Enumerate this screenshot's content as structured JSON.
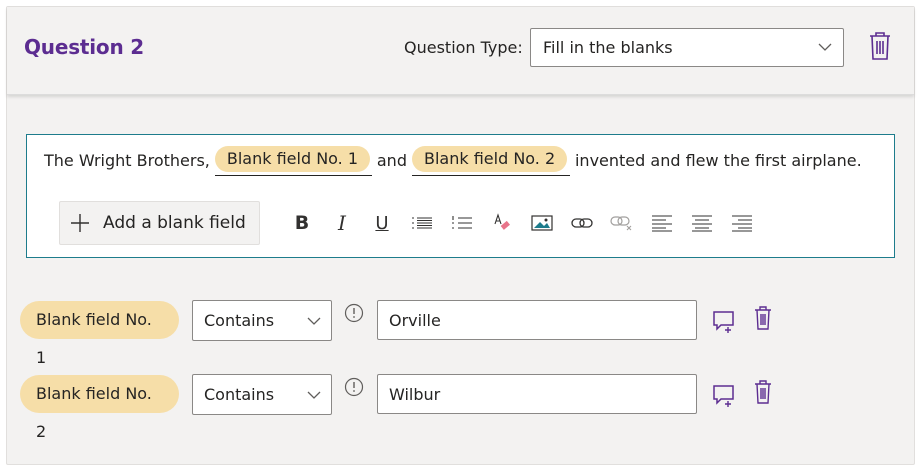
{
  "question": {
    "title": "Question 2",
    "type_label": "Question Type:",
    "type_value": "Fill in the blanks"
  },
  "editor": {
    "text_before": "The Wright Brothers,",
    "blank1": "Blank field No. 1",
    "text_middle": "and",
    "blank2": "Blank field No. 2",
    "text_after": "invented and flew the first airplane.",
    "add_blank_label": "Add a blank field",
    "toolbar": {
      "bold": "B",
      "italic": "I",
      "underline": "U",
      "icons": [
        "bold-icon",
        "italic-icon",
        "underline-icon",
        "bulleted-list-icon",
        "numbered-list-icon",
        "clear-format-icon",
        "image-icon",
        "link-icon",
        "unlink-icon",
        "align-left-icon",
        "align-center-icon",
        "align-right-icon"
      ]
    }
  },
  "answers": [
    {
      "blank_label": "Blank field No. 1",
      "match_type": "Contains",
      "value": "Orville"
    },
    {
      "blank_label": "Blank field No. 2",
      "match_type": "Contains",
      "value": "Wilbur"
    }
  ],
  "colors": {
    "title": "#5c2d91",
    "pill": "#f6dea8",
    "editor_border": "#1d7c8c",
    "icon_purple": "#5c2d91"
  }
}
